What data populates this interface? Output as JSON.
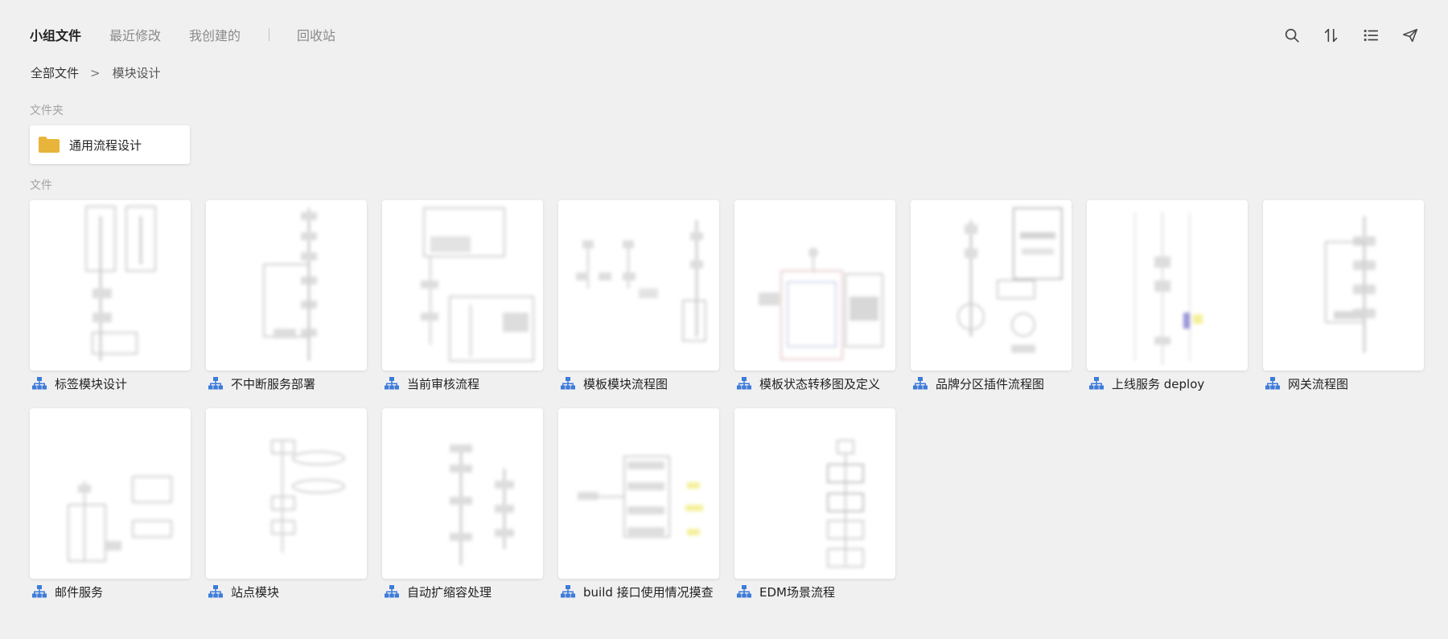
{
  "nav": {
    "tabs": [
      {
        "label": "小组文件",
        "active": true
      },
      {
        "label": "最近修改",
        "active": false
      },
      {
        "label": "我创建的",
        "active": false
      }
    ],
    "trash_label": "回收站"
  },
  "toolbar": {
    "icons": [
      "search-icon",
      "sort-icon",
      "list-view-icon",
      "send-icon"
    ]
  },
  "breadcrumb": {
    "root": "全部文件",
    "separator": ">",
    "current": "模块设计"
  },
  "sections": {
    "folders_label": "文件夹",
    "files_label": "文件"
  },
  "folders": [
    {
      "name": "通用流程设计",
      "icon": "folder-icon"
    }
  ],
  "files": [
    {
      "name": "标签模块设计",
      "icon": "flowchart-icon"
    },
    {
      "name": "不中断服务部署",
      "icon": "flowchart-icon"
    },
    {
      "name": "当前审核流程",
      "icon": "flowchart-icon"
    },
    {
      "name": "模板模块流程图",
      "icon": "flowchart-icon"
    },
    {
      "name": "模板状态转移图及定义",
      "icon": "flowchart-icon"
    },
    {
      "name": "品牌分区插件流程图",
      "icon": "flowchart-icon"
    },
    {
      "name": "上线服务 deploy",
      "icon": "flowchart-icon"
    },
    {
      "name": "网关流程图",
      "icon": "flowchart-icon"
    },
    {
      "name": "邮件服务",
      "icon": "flowchart-icon"
    },
    {
      "name": "站点模块",
      "icon": "flowchart-icon"
    },
    {
      "name": "自动扩缩容处理",
      "icon": "flowchart-icon"
    },
    {
      "name": "build 接口使用情况摸查",
      "icon": "flowchart-icon"
    },
    {
      "name": "EDM场景流程",
      "icon": "flowchart-icon"
    }
  ],
  "colors": {
    "background": "#f0f0f0",
    "folder": "#e8b53a",
    "file_icon": "#3d7bd9",
    "highlight_yellow": "#f5f09a",
    "highlight_purple": "#9a96d8"
  }
}
